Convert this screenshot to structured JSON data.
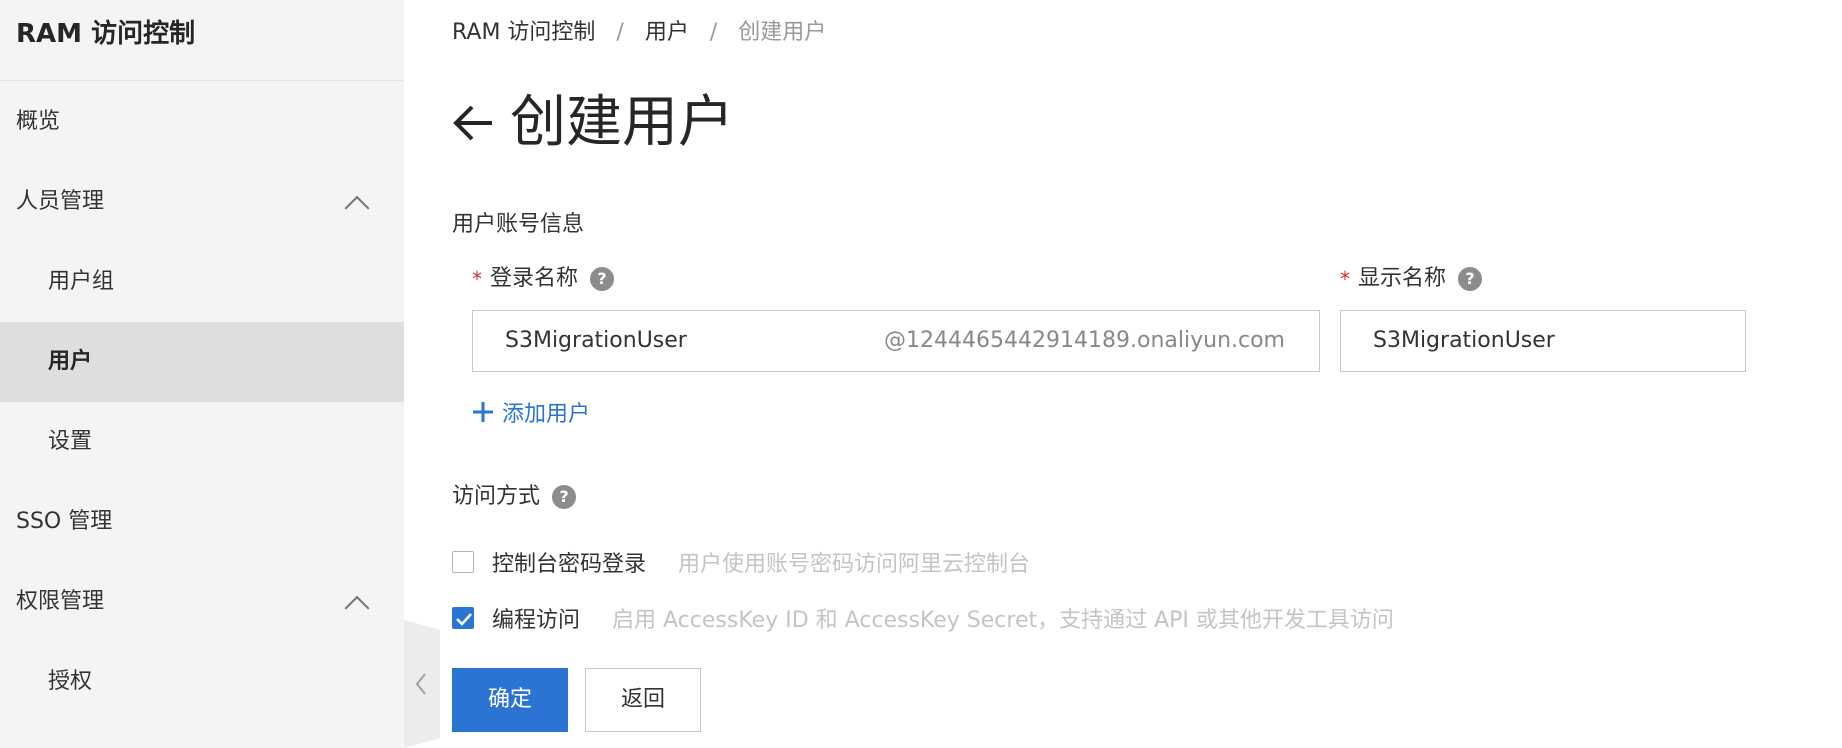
{
  "sidebar": {
    "title": "RAM 访问控制",
    "items": [
      {
        "label": "概览"
      },
      {
        "label": "人员管理"
      },
      {
        "label": "用户组"
      },
      {
        "label": "用户"
      },
      {
        "label": "设置"
      },
      {
        "label": "SSO 管理"
      },
      {
        "label": "权限管理"
      },
      {
        "label": "授权"
      }
    ],
    "active_item": "用户"
  },
  "breadcrumb": {
    "items": [
      "RAM 访问控制",
      "用户",
      "创建用户"
    ],
    "separator": "/"
  },
  "page": {
    "title": "创建用户"
  },
  "form": {
    "section_account": "用户账号信息",
    "login_name": {
      "label": "登录名称",
      "value": "S3MigrationUser",
      "suffix": "@1244465442914189.onaliyun.com"
    },
    "display_name": {
      "label": "显示名称",
      "value": "S3MigrationUser"
    },
    "add_user_label": "添加用户",
    "section_access": "访问方式",
    "access_options": [
      {
        "label": "控制台密码登录",
        "hint": "用户使用账号密码访问阿里云控制台",
        "checked": false
      },
      {
        "label": "编程访问",
        "hint": "启用 AccessKey ID 和 AccessKey Secret，支持通过 API 或其他开发工具访问",
        "checked": true
      }
    ],
    "confirm_label": "确定",
    "back_label": "返回"
  },
  "colors": {
    "primary": "#2b74d4",
    "required": "#d93026",
    "sidebar_bg": "#f4f4f4",
    "sidebar_active_bg": "#dedede"
  }
}
